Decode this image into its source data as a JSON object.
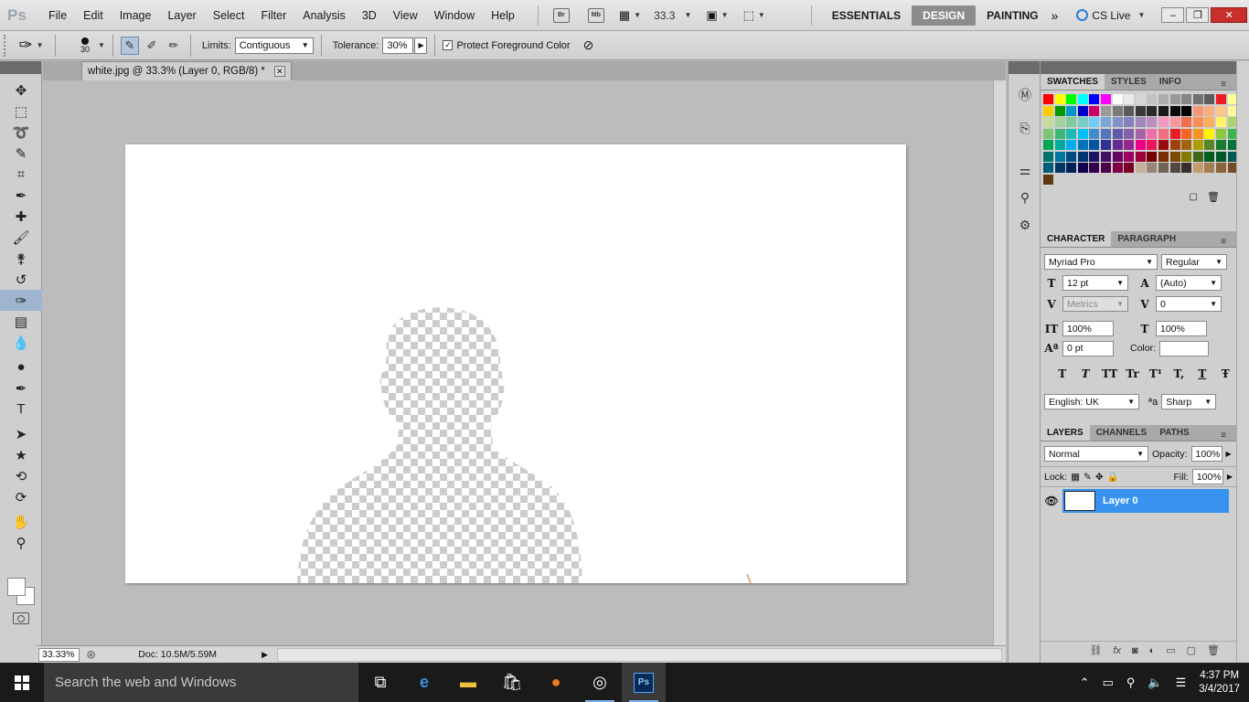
{
  "app": {
    "logo": "Ps",
    "title": "white.jpg @ 33.3% (Layer 0, RGB/8) *"
  },
  "menu": [
    "File",
    "Edit",
    "Image",
    "Layer",
    "Select",
    "Filter",
    "Analysis",
    "3D",
    "View",
    "Window",
    "Help"
  ],
  "menubar": {
    "bridge": "Br",
    "minibridge": "Mb",
    "zoom": "33.3"
  },
  "workspaces": [
    "ESSENTIALS",
    "DESIGN",
    "PAINTING"
  ],
  "workspace_active": "DESIGN",
  "cslive": "CS Live",
  "options": {
    "brush_size": "30",
    "limits_label": "Limits:",
    "limits_value": "Contiguous",
    "tolerance_label": "Tolerance:",
    "tolerance_value": "30%",
    "protect_label": "Protect Foreground Color"
  },
  "tools": [
    "move-tool",
    "marquee-tool",
    "lasso-tool",
    "quick-select-tool",
    "crop-tool",
    "eyedropper-tool",
    "spot-heal-tool",
    "brush-tool",
    "clone-stamp-tool",
    "history-brush-tool",
    "background-eraser-tool",
    "gradient-tool",
    "blur-tool",
    "dodge-tool",
    "pen-tool",
    "type-tool",
    "path-select-tool",
    "shape-tool",
    "3d-rotate-tool",
    "3d-orbit-tool",
    "hand-tool",
    "zoom-tool"
  ],
  "status": {
    "zoom": "33.33%",
    "doc": "Doc: 10.5M/5.59M"
  },
  "panels": {
    "swatches_tabs": [
      "SWATCHES",
      "STYLES",
      "INFO"
    ],
    "swatch_colors": [
      "#ff0000",
      "#ffff00",
      "#00ff00",
      "#00ffff",
      "#0000ff",
      "#ff00ff",
      "#ffffff",
      "#ebebeb",
      "#d6d6d6",
      "#c2c2c2",
      "#adadad",
      "#999999",
      "#858585",
      "#707070",
      "#5c5c5c",
      "#ed1c24",
      "#ffff99",
      "#ffcc00",
      "#009900",
      "#0099cc",
      "#0000cc",
      "#cc0066",
      "#9a9a9a",
      "#7a7a7a",
      "#5a5a5a",
      "#3a3a3a",
      "#2a2a2a",
      "#1a1a1a",
      "#0a0a0a",
      "#000000",
      "#f7977a",
      "#f9ad81",
      "#fdc68a",
      "#fff79a",
      "#c4df9b",
      "#a3d39c",
      "#82ca9d",
      "#7accc8",
      "#6dcff6",
      "#7da7d9",
      "#8393ca",
      "#8781bd",
      "#a187be",
      "#bc8dbf",
      "#f49ac2",
      "#f6989d",
      "#f26c4f",
      "#f68e55",
      "#fbaf5c",
      "#fff467",
      "#acd372",
      "#7cc576",
      "#3bb878",
      "#1abbb4",
      "#00bff3",
      "#438ccb",
      "#5574b9",
      "#605ca8",
      "#855fa8",
      "#a763a8",
      "#f06ea9",
      "#f26d7d",
      "#ed1c24",
      "#f26522",
      "#f7941d",
      "#fff200",
      "#8dc63f",
      "#39b54a",
      "#00a651",
      "#00a99d",
      "#00aeef",
      "#0072bc",
      "#0054a6",
      "#2e3192",
      "#662d91",
      "#92278f",
      "#ec008c",
      "#ed145b",
      "#9e0b0f",
      "#a0410d",
      "#a36209",
      "#aba000",
      "#598527",
      "#197b30",
      "#007236",
      "#00746b",
      "#0076a3",
      "#004b80",
      "#003471",
      "#1b1464",
      "#440e62",
      "#630460",
      "#9e005d",
      "#9e0039",
      "#790000",
      "#7b2e00",
      "#7d4900",
      "#827b00",
      "#406618",
      "#005e20",
      "#005826",
      "#005952",
      "#005b7f",
      "#003663",
      "#002157",
      "#0d004c",
      "#32004b",
      "#4b0049",
      "#7b0046",
      "#7a0026",
      "#c7b299",
      "#998675",
      "#736357",
      "#534741",
      "#37302d",
      "#c69c6d",
      "#a67c52",
      "#8c6239",
      "#754c24",
      "#603913"
    ],
    "character_tabs": [
      "CHARACTER",
      "PARAGRAPH"
    ],
    "font_family": "Myriad Pro",
    "font_style": "Regular",
    "font_size": "12 pt",
    "leading": "(Auto)",
    "kerning": "Metrics",
    "tracking": "0",
    "vscale": "100%",
    "hscale": "100%",
    "baseline": "0 pt",
    "color_label": "Color:",
    "text_styles": [
      "T",
      "T",
      "TT",
      "Tr",
      "T¹",
      "T,",
      "T",
      "Ŧ"
    ],
    "language": "English: UK",
    "aa_icon": "ªa",
    "antialias": "Sharp",
    "layers_tabs": [
      "LAYERS",
      "CHANNELS",
      "PATHS"
    ],
    "blend": "Normal",
    "opacity_label": "Opacity:",
    "opacity": "100%",
    "lock_label": "Lock:",
    "fill_label": "Fill:",
    "fill": "100%",
    "layer_name": "Layer 0"
  },
  "taskbar": {
    "search": "Search the web and Windows",
    "time": "4:37 PM",
    "date": "3/4/2017"
  },
  "colors": {
    "accent": "#3893f0",
    "design_tab": "#8c8c8c"
  }
}
